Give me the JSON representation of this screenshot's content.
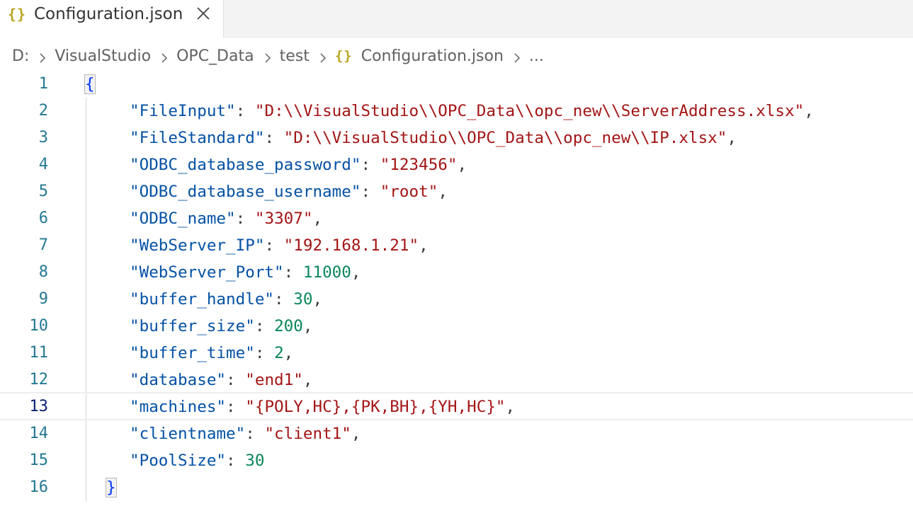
{
  "tab": {
    "icon": "{}",
    "label": "Configuration.json"
  },
  "breadcrumb": {
    "items": [
      "D:",
      "VisualStudio",
      "OPC_Data",
      "test"
    ],
    "file_icon": "{}",
    "file": "Configuration.json",
    "ellipsis": "..."
  },
  "editor": {
    "current_line": 13,
    "lines": [
      {
        "num": "1",
        "open": "{"
      },
      {
        "num": "2",
        "key": "\"FileInput\"",
        "sep": ": ",
        "str": "\"D:\\\\VisualStudio\\\\OPC_Data\\\\opc_new\\\\ServerAddress.xlsx\"",
        "end": ","
      },
      {
        "num": "3",
        "key": "\"FileStandard\"",
        "sep": ": ",
        "str": "\"D:\\\\VisualStudio\\\\OPC_Data\\\\opc_new\\\\IP.xlsx\"",
        "end": ","
      },
      {
        "num": "4",
        "key": "\"ODBC_database_password\"",
        "sep": ": ",
        "str": "\"123456\"",
        "end": ","
      },
      {
        "num": "5",
        "key": "\"ODBC_database_username\"",
        "sep": ": ",
        "str": "\"root\"",
        "end": ","
      },
      {
        "num": "6",
        "key": "\"ODBC_name\"",
        "sep": ": ",
        "str": "\"3307\"",
        "end": ","
      },
      {
        "num": "7",
        "key": "\"WebServer_IP\"",
        "sep": ": ",
        "str": "\"192.168.1.21\"",
        "end": ","
      },
      {
        "num": "8",
        "key": "\"WebServer_Port\"",
        "sep": ": ",
        "n": "11000",
        "end": ","
      },
      {
        "num": "9",
        "key": "\"buffer_handle\"",
        "sep": ": ",
        "n": "30",
        "end": ","
      },
      {
        "num": "10",
        "key": "\"buffer_size\"",
        "sep": ": ",
        "n": "200",
        "end": ","
      },
      {
        "num": "11",
        "key": "\"buffer_time\"",
        "sep": ": ",
        "n": "2",
        "end": ","
      },
      {
        "num": "12",
        "key": "\"database\"",
        "sep": ": ",
        "str": "\"end1\"",
        "end": ","
      },
      {
        "num": "13",
        "key": "\"machines\"",
        "sep": ": ",
        "str": "\"{POLY,HC},{PK,BH},{YH,HC}\"",
        "end": ","
      },
      {
        "num": "14",
        "key": "\"clientname\"",
        "sep": ": ",
        "str": "\"client1\"",
        "end": ","
      },
      {
        "num": "15",
        "key": "\"PoolSize\"",
        "sep": ": ",
        "n": "30",
        "end": ""
      },
      {
        "num": "16",
        "close": "}"
      }
    ]
  },
  "colors": {
    "key": "#0451a5",
    "string": "#a31515",
    "number": "#098658",
    "brace": "#0431fa",
    "line_number": "#237893",
    "json_icon": "#b8a621"
  }
}
